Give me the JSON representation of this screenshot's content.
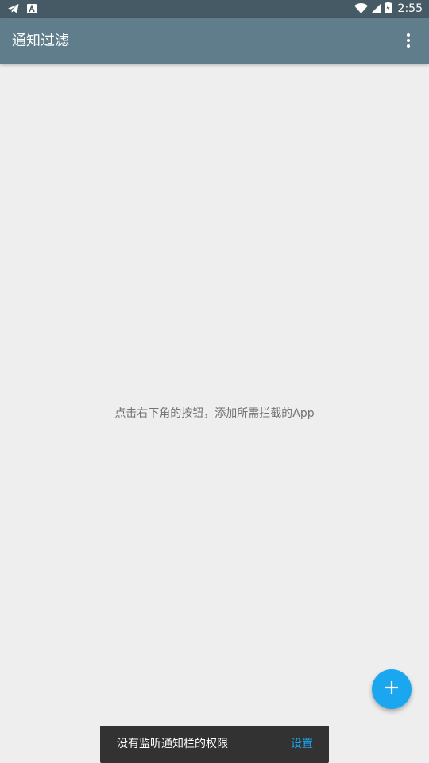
{
  "status_bar": {
    "time": "2:55",
    "left_icons": [
      "telegram-icon",
      "a-notification-icon"
    ],
    "right_icons": [
      "wifi-icon",
      "cell-signal-icon",
      "battery-icon"
    ]
  },
  "app_bar": {
    "title": "通知过滤",
    "overflow_icon": "more-vert-icon"
  },
  "empty_state": {
    "message": "点击右下角的按钮，添加所需拦截的App"
  },
  "fab": {
    "icon": "plus-icon"
  },
  "snackbar": {
    "message": "没有监听通知栏的权限",
    "action_label": "设置"
  },
  "colors": {
    "status_bar": "#455a64",
    "app_bar": "#607d8b",
    "background": "#eeeeee",
    "accent": "#1aa7f0",
    "snackbar": "#323232"
  }
}
